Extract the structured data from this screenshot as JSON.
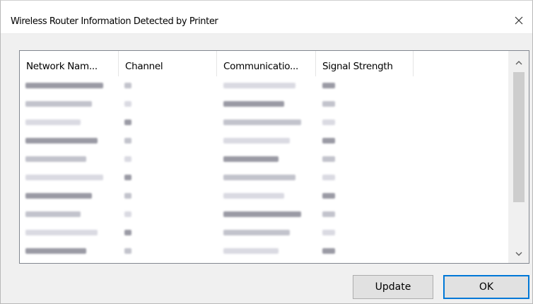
{
  "window": {
    "title": "Wireless Router Information Detected by Printer"
  },
  "list": {
    "columns": [
      {
        "label": "Network Nam..."
      },
      {
        "label": "Channel"
      },
      {
        "label": "Communicatio..."
      },
      {
        "label": "Signal Strength"
      }
    ]
  },
  "buttons": {
    "update_label": "Update",
    "ok_label": "OK"
  },
  "colors": {
    "accent": "#0078d7",
    "blur_dark": "#9a9aa4",
    "blur_mid": "#c2c3cc",
    "blur_light": "#dadae2"
  }
}
